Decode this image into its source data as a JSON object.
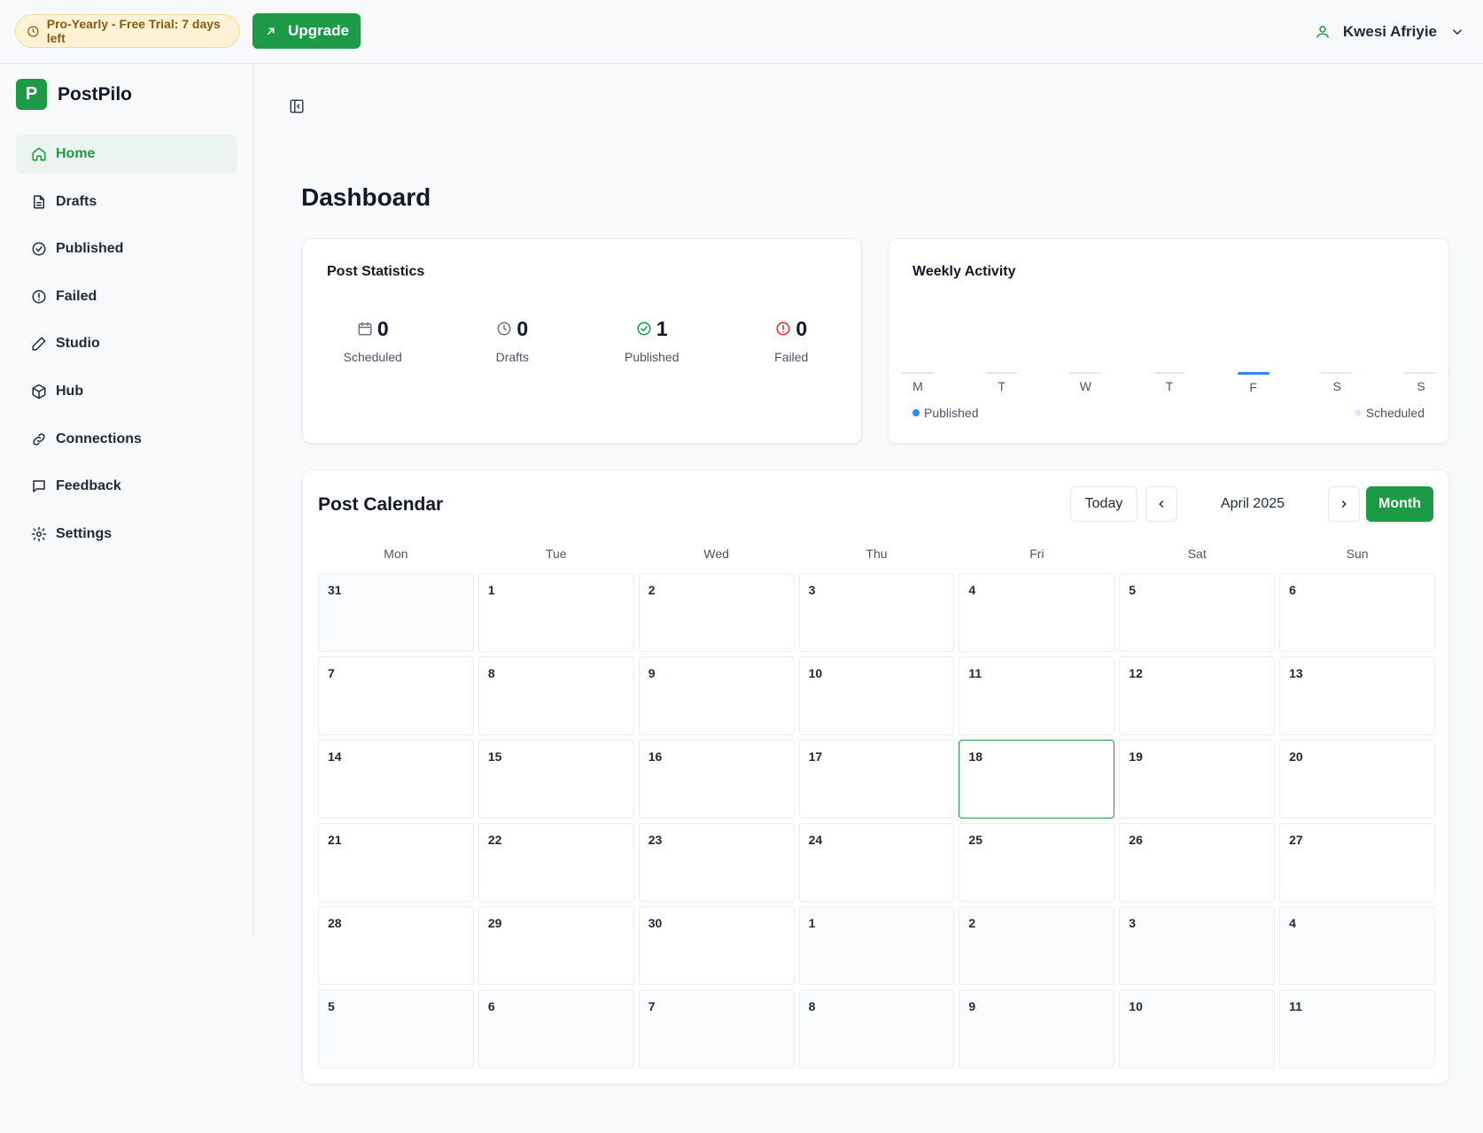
{
  "topbar": {
    "trial_badge": "Pro-Yearly - Free Trial: 7 days left",
    "upgrade_label": "Upgrade",
    "user_name": "Kwesi Afriyie"
  },
  "brand": {
    "logo_letter": "P",
    "name": "PostPilo"
  },
  "sidebar": {
    "items": [
      {
        "label": "Home",
        "icon": "home-icon",
        "active": true
      },
      {
        "label": "Drafts",
        "icon": "document-icon"
      },
      {
        "label": "Published",
        "icon": "check-circle-icon"
      },
      {
        "label": "Failed",
        "icon": "alert-circle-icon"
      },
      {
        "label": "Studio",
        "icon": "pencil-icon"
      },
      {
        "label": "Hub",
        "icon": "package-icon"
      },
      {
        "label": "Connections",
        "icon": "link-icon"
      },
      {
        "label": "Feedback",
        "icon": "message-square-icon"
      },
      {
        "label": "Settings",
        "icon": "gear-icon"
      }
    ]
  },
  "main": {
    "title": "Dashboard"
  },
  "post_statistics": {
    "title": "Post Statistics",
    "stats": [
      {
        "value": "0",
        "label": "Scheduled",
        "icon": "calendar-icon",
        "color": "#6b7280"
      },
      {
        "value": "0",
        "label": "Drafts",
        "icon": "clock-icon",
        "color": "#6b7280"
      },
      {
        "value": "1",
        "label": "Published",
        "icon": "check-circle-icon",
        "color": "#1c9a45"
      },
      {
        "value": "0",
        "label": "Failed",
        "icon": "alert-circle-icon",
        "color": "#dc2626"
      }
    ]
  },
  "weekly_activity": {
    "title": "Weekly Activity",
    "legend": {
      "published": "Published",
      "scheduled": "Scheduled"
    },
    "colors": {
      "published": "#3b82f6",
      "scheduled": "#dbeafe"
    },
    "days": [
      {
        "label": "M",
        "published": 0
      },
      {
        "label": "T",
        "published": 0
      },
      {
        "label": "W",
        "published": 0
      },
      {
        "label": "T",
        "published": 0
      },
      {
        "label": "F",
        "published": 1
      },
      {
        "label": "S",
        "published": 0
      },
      {
        "label": "S",
        "published": 0
      }
    ]
  },
  "calendar": {
    "title": "Post Calendar",
    "today_label": "Today",
    "month_label": "April 2025",
    "view_label": "Month",
    "weekdays": [
      "Mon",
      "Tue",
      "Wed",
      "Thu",
      "Fri",
      "Sat",
      "Sun"
    ],
    "today_day": "18",
    "days": [
      {
        "d": "31",
        "out": true
      },
      {
        "d": "1"
      },
      {
        "d": "2"
      },
      {
        "d": "3"
      },
      {
        "d": "4"
      },
      {
        "d": "5"
      },
      {
        "d": "6"
      },
      {
        "d": "7"
      },
      {
        "d": "8"
      },
      {
        "d": "9"
      },
      {
        "d": "10"
      },
      {
        "d": "11"
      },
      {
        "d": "12"
      },
      {
        "d": "13"
      },
      {
        "d": "14"
      },
      {
        "d": "15"
      },
      {
        "d": "16"
      },
      {
        "d": "17"
      },
      {
        "d": "18",
        "today": true
      },
      {
        "d": "19"
      },
      {
        "d": "20"
      },
      {
        "d": "21"
      },
      {
        "d": "22"
      },
      {
        "d": "23"
      },
      {
        "d": "24"
      },
      {
        "d": "25"
      },
      {
        "d": "26"
      },
      {
        "d": "27"
      },
      {
        "d": "28"
      },
      {
        "d": "29"
      },
      {
        "d": "30"
      },
      {
        "d": "1",
        "out": true
      },
      {
        "d": "2",
        "out": true
      },
      {
        "d": "3",
        "out": true
      },
      {
        "d": "4",
        "out": true
      },
      {
        "d": "5",
        "out": true
      },
      {
        "d": "6",
        "out": true
      },
      {
        "d": "7",
        "out": true
      },
      {
        "d": "8",
        "out": true
      },
      {
        "d": "9",
        "out": true
      },
      {
        "d": "10",
        "out": true
      },
      {
        "d": "11",
        "out": true
      }
    ]
  }
}
